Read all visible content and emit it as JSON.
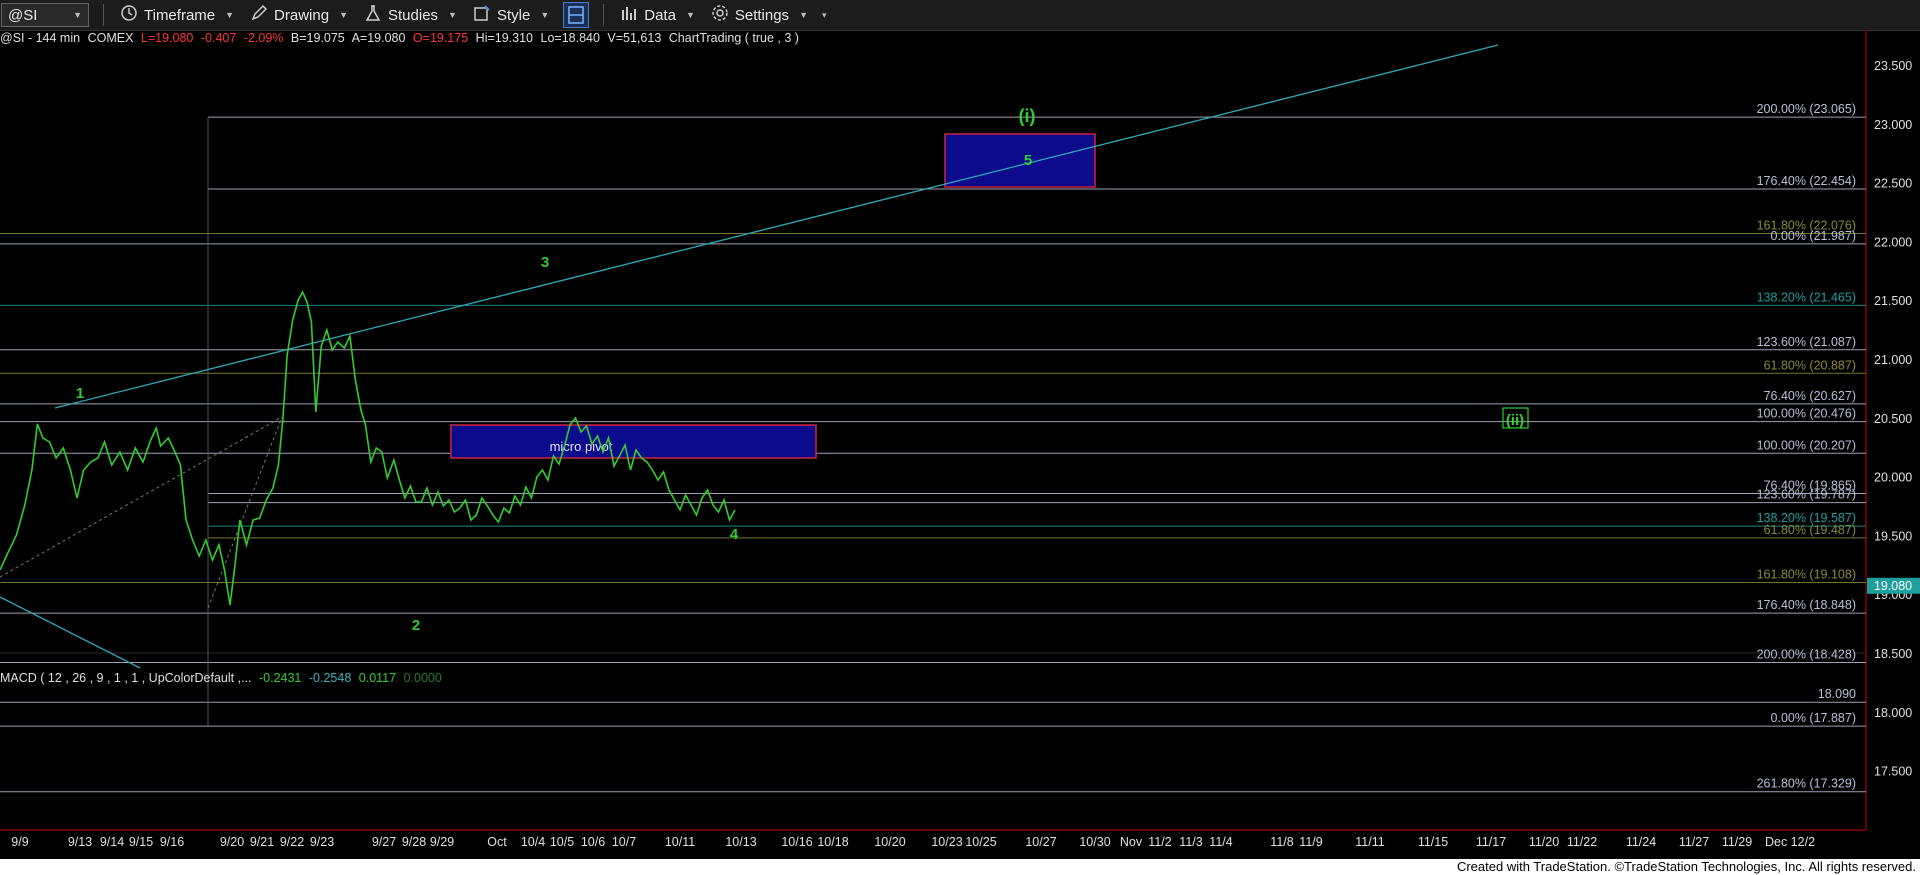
{
  "toolbar": {
    "symbol": "@SI",
    "timeframe": "Timeframe",
    "drawing": "Drawing",
    "studies": "Studies",
    "style": "Style",
    "data": "Data",
    "settings": "Settings"
  },
  "info": {
    "symbol_desc": "@SI - 144 min",
    "exchange": "COMEX",
    "last": "L=19.080",
    "change": "-0.407",
    "change_pct": "-2.09%",
    "bid": "B=19.075",
    "ask": "A=19.080",
    "open": "O=19.175",
    "high": "Hi=19.310",
    "low": "Lo=18.840",
    "volume": "V=51,613",
    "study": "ChartTrading ( true , 3 )"
  },
  "macd": {
    "label": "MACD ( 12 , 26 , 9 , 1 , 1 , UpColorDefault ,...",
    "v1": "-0.2431",
    "v2": "-0.2548",
    "v3": "0.0117",
    "v4": "0.0000"
  },
  "colors": {
    "green": "#33cc33",
    "red": "#ff3333",
    "trendline": "#2fa8b8",
    "box_fill": "#0b0b8c",
    "box_border": "#cc2244",
    "price_tag": "#1f9e9e"
  },
  "price_axis": {
    "labels": [
      "23.500",
      "23.000",
      "22.500",
      "22.000",
      "21.500",
      "21.000",
      "20.500",
      "20.000",
      "19.500",
      "19.000",
      "18.500",
      "18.000",
      "17.500"
    ],
    "current_tag": "19.080"
  },
  "date_axis": [
    "9/9",
    "9/13",
    "9/14",
    "9/15",
    "9/16",
    "9/20",
    "9/21",
    "9/22",
    "9/23",
    "9/27",
    "9/28",
    "9/29",
    "Oct",
    "10/4",
    "10/5",
    "10/6",
    "10/7",
    "10/11",
    "10/13",
    "10/16",
    "10/18",
    "10/20",
    "10/23",
    "10/25",
    "10/27",
    "10/30",
    "Nov",
    "11/2",
    "11/3",
    "11/4",
    "11/8",
    "11/9",
    "11/11",
    "11/15",
    "11/17",
    "11/20",
    "11/22",
    "11/24",
    "11/27",
    "11/29",
    "Dec 12/2"
  ],
  "fib_levels": [
    {
      "label": "200.00% (23.065)",
      "price": 23.065,
      "color": "#b8c0d8"
    },
    {
      "label": "176.40% (22.454)",
      "price": 22.454,
      "color": "#b8c0d8"
    },
    {
      "label": "161.80% (22.076)",
      "price": 22.076,
      "color": "#8a8a3a"
    },
    {
      "label": "0.00% (21.987)",
      "price": 21.987,
      "color": "#b8c0d8"
    },
    {
      "label": "138.20% (21.465)",
      "price": 21.465,
      "color": "#1f9e9e"
    },
    {
      "label": "123.60% (21.087)",
      "price": 21.087,
      "color": "#b8c0d8"
    },
    {
      "label": "61.80% (20.887)",
      "price": 20.887,
      "color": "#8a8a3a"
    },
    {
      "label": "76.40% (20.627)",
      "price": 20.627,
      "color": "#b8c0d8"
    },
    {
      "label": "100.00% (20.476)",
      "price": 20.476,
      "color": "#b8c0d8"
    },
    {
      "label": "100.00% (20.207)",
      "price": 20.207,
      "color": "#b8c0d8"
    },
    {
      "label": "76.40% (19.865)",
      "price": 19.865,
      "color": "#b8c0d8"
    },
    {
      "label": "123.60% (19.787)",
      "price": 19.787,
      "color": "#b8c0d8"
    },
    {
      "label": "138.20% (19.587)",
      "price": 19.587,
      "color": "#1f9e9e"
    },
    {
      "label": "61.80% (19.487)",
      "price": 19.487,
      "color": "#8a8a3a"
    },
    {
      "label": "161.80% (19.108)",
      "price": 19.108,
      "color": "#8a8a3a"
    },
    {
      "label": "176.40% (18.848)",
      "price": 18.848,
      "color": "#b8c0d8"
    },
    {
      "label": "200.00% (18.428)",
      "price": 18.428,
      "color": "#b8c0d8"
    },
    {
      "label": "18.090",
      "price": 18.09,
      "color": "#b8c0d8"
    },
    {
      "label": "0.00% (17.887)",
      "price": 17.887,
      "color": "#b8c0d8"
    },
    {
      "label": "261.80% (17.329)",
      "price": 17.329,
      "color": "#b8c0d8"
    }
  ],
  "wave_labels": [
    "1",
    "2",
    "3",
    "4",
    "5",
    "(i)",
    "(ii)"
  ],
  "zones": {
    "micro_pivot": "micro pivot"
  },
  "footer": "Created with TradeStation. ©TradeStation Technologies, Inc. All rights reserved."
}
